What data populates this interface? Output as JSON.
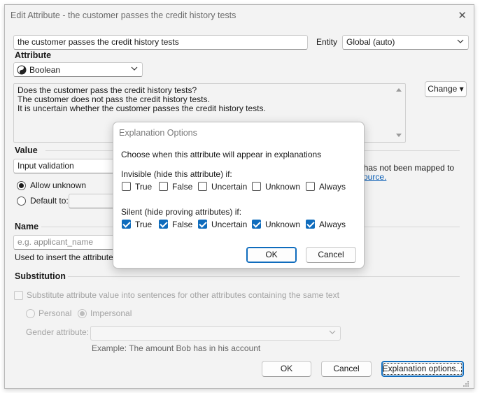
{
  "window": {
    "title": "Edit Attribute - the customer passes the credit history tests",
    "close_glyph": "✕"
  },
  "attribute_text": "the customer passes the credit history tests",
  "entity": {
    "label": "Entity",
    "value": "Global (auto)"
  },
  "attribute_section": {
    "label": "Attribute",
    "type_value": "Boolean",
    "type_icon": "yin-yang-icon",
    "descriptions": [
      "Does the customer pass the credit history tests?",
      "The customer does not pass the credit history tests.",
      "It is uncertain whether the customer passes the credit history tests."
    ],
    "change_button": "Change ▾"
  },
  "value_section": {
    "label": "Value",
    "mode_value": "Input validation",
    "allow_unknown": "Allow unknown",
    "default_to": "Default to:",
    "mapping_note_part": "t has not been mapped to",
    "mapping_link_part": "source."
  },
  "name_section": {
    "label": "Name",
    "placeholder": "e.g. applicant_name",
    "hint_part": "Used to insert the attribute's va"
  },
  "substitution_section": {
    "label": "Substitution",
    "checkbox_label": "Substitute attribute value into sentences for other attributes containing the same text",
    "personal": "Personal",
    "impersonal": "Impersonal",
    "gender_label": "Gender attribute:",
    "example": "Example: The amount Bob has in his account"
  },
  "footer": {
    "ok": "OK",
    "cancel": "Cancel",
    "explanation_options": "Explanation options..."
  },
  "dialog": {
    "title": "Explanation Options",
    "intro": "Choose when this attribute will appear in explanations",
    "invisible_label": "Invisible (hide this attribute) if:",
    "silent_label": "Silent (hide proving attributes) if:",
    "options": [
      "True",
      "False",
      "Uncertain",
      "Unknown",
      "Always"
    ],
    "invisible_checked": [
      false,
      false,
      false,
      false,
      false
    ],
    "silent_checked": [
      true,
      true,
      true,
      true,
      true
    ],
    "ok": "OK",
    "cancel": "Cancel"
  },
  "colors": {
    "accent": "#0f6cbd",
    "link": "#0b5fb5"
  }
}
